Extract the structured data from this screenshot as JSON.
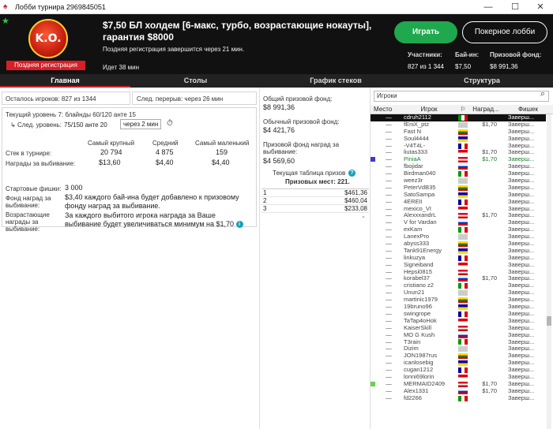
{
  "window": {
    "title": "Лобби турнира 2969845051",
    "minimize": "—",
    "maximize": "☐",
    "close": "✕"
  },
  "header": {
    "logo_text": "K.O.",
    "late_registration": "Поздняя регистрация",
    "title": "$7,50 БЛ холдем [6-макс, турбо, возрастающие нокауты], гарантия $8000",
    "reg_note": "Поздняя регистрация завершится через 21 мин.",
    "running": "Идет 38 мин",
    "play_label": "Играть",
    "lobby_label": "Покерное лобби",
    "participants_label": "Участники:",
    "participants_value": "827 из 1 344",
    "buyin_label": "Бай-ин:",
    "buyin_value": "$7,50",
    "prize_label": "Призовой фонд:",
    "prize_value": "$8 991,36"
  },
  "tabs": [
    "Главная",
    "Столы",
    "График стеков",
    "Структура"
  ],
  "main": {
    "players_left": "Осталось игроков: 827 из 1344",
    "next_break": "След. перерыв: через 26 мин",
    "current_level": "Текущий уровень 7:  блайнды 60/120 анте 15",
    "next_level_label": "След. уровень:",
    "next_level_value": "75/150 анте 20",
    "next_level_time": "через 2 мин",
    "stack_headers": [
      "Самый крупный",
      "Средний",
      "Самый маленький"
    ],
    "stack_row_label": "Стек в турнире:",
    "stack_values": [
      "20 794",
      "4 875",
      "159"
    ],
    "bounty_row_label": "Награды за выбивание:",
    "bounty_values": [
      "$13,60",
      "$4,40",
      "$4,40"
    ],
    "start_chips_label": "Стартовые фишки:",
    "start_chips_value": "3 000",
    "bounty_fund_label": "Фонд наград за выбивание:",
    "bounty_fund_value": "$3,40 каждого бай-ина будет добавлено к призовому фонду наград за выбивание.",
    "progressive_label": "Возрастающие награды за выбивание:",
    "progressive_value": "За каждого выбитого игрока награда за Ваше выбивание будет увеличиваться минимум на $1,70"
  },
  "prizes": {
    "total_label": "Общий призовой фонд:",
    "total_value": "$8 991,36",
    "regular_label": "Обычный призовой фонд:",
    "regular_value": "$4 421,76",
    "bounty_label": "Призовой фонд наград за выбивание:",
    "bounty_value": "$4 569,60",
    "current_table_label": "Текущая таблица призов",
    "places_label": "Призовых мест: 221.",
    "rows": [
      {
        "place": "1",
        "amount": "$461,36"
      },
      {
        "place": "2",
        "amount": "$460,04"
      },
      {
        "place": "3",
        "amount": "$233,08"
      }
    ]
  },
  "players": {
    "search_placeholder": "Игроки",
    "headers": {
      "place": "Место",
      "name": "Игрок",
      "flag": "⚐",
      "bounty": "Наград...",
      "chips": "Фишек"
    },
    "rows": [
      {
        "place": "—",
        "name": "cdruh2112",
        "bounty": "",
        "chips": "Заверш..."
      },
      {
        "place": "—",
        "name": "fEniX_ptz",
        "bounty": "$1,70",
        "chips": "Заверш..."
      },
      {
        "place": "—",
        "name": "Fast N",
        "bounty": "",
        "chips": "Заверш..."
      },
      {
        "place": "—",
        "name": "Soul4444",
        "bounty": "",
        "chips": "Заверш..."
      },
      {
        "place": "—",
        "name": "-V4T4L-",
        "bounty": "",
        "chips": "Заверш..."
      },
      {
        "place": "—",
        "name": "liutas333",
        "bounty": "$1,70",
        "chips": "Заверш..."
      },
      {
        "place": "—",
        "name": "PiniaA",
        "bounty": "$1,70",
        "chips": "Заверш..."
      },
      {
        "place": "—",
        "name": "fbojidar",
        "bounty": "",
        "chips": "Заверш..."
      },
      {
        "place": "—",
        "name": "Birdman040",
        "bounty": "",
        "chips": "Заверш..."
      },
      {
        "place": "—",
        "name": "weez3r",
        "bounty": "",
        "chips": "Заверш..."
      },
      {
        "place": "—",
        "name": "PeterVdB35",
        "bounty": "",
        "chips": "Заверш..."
      },
      {
        "place": "—",
        "name": "SatoSampa",
        "bounty": "",
        "chips": "Заверш..."
      },
      {
        "place": "—",
        "name": "4EREII",
        "bounty": "",
        "chips": "Заверш..."
      },
      {
        "place": "—",
        "name": "mexico_VI",
        "bounty": "",
        "chips": "Заверш..."
      },
      {
        "place": "—",
        "name": "AlexxxandrL",
        "bounty": "$1,70",
        "chips": "Заверш..."
      },
      {
        "place": "—",
        "name": "V for Vardan",
        "bounty": "",
        "chips": "Заверш..."
      },
      {
        "place": "—",
        "name": "exKam",
        "bounty": "",
        "chips": "Заверш..."
      },
      {
        "place": "—",
        "name": "LanexPro",
        "bounty": "",
        "chips": "Заверш..."
      },
      {
        "place": "—",
        "name": "abyss333",
        "bounty": "",
        "chips": "Заверш..."
      },
      {
        "place": "—",
        "name": "Tank91Energy",
        "bounty": "",
        "chips": "Заверш..."
      },
      {
        "place": "—",
        "name": "linkuzya",
        "bounty": "",
        "chips": "Заверш..."
      },
      {
        "place": "—",
        "name": "Signeiband",
        "bounty": "",
        "chips": "Заверш..."
      },
      {
        "place": "—",
        "name": "Hepsi0815",
        "bounty": "",
        "chips": "Заверш..."
      },
      {
        "place": "—",
        "name": "korabel37",
        "bounty": "$1,70",
        "chips": "Заверш..."
      },
      {
        "place": "—",
        "name": "cristiano z2",
        "bounty": "",
        "chips": "Заверш..."
      },
      {
        "place": "—",
        "name": "Unun21",
        "bounty": "",
        "chips": "Заверш..."
      },
      {
        "place": "—",
        "name": "martinic1979",
        "bounty": "",
        "chips": "Заверш..."
      },
      {
        "place": "—",
        "name": "19bruno96",
        "bounty": "",
        "chips": "Заверш..."
      },
      {
        "place": "—",
        "name": "swingrope",
        "bounty": "",
        "chips": "Заверш..."
      },
      {
        "place": "—",
        "name": "TaTap4oHok",
        "bounty": "",
        "chips": "Заверш..."
      },
      {
        "place": "—",
        "name": "KaiserSkill",
        "bounty": "",
        "chips": "Заверш..."
      },
      {
        "place": "—",
        "name": "MO G Kush",
        "bounty": "",
        "chips": "Заверш..."
      },
      {
        "place": "—",
        "name": "T3rain",
        "bounty": "",
        "chips": "Заверш..."
      },
      {
        "place": "—",
        "name": "Dizim",
        "bounty": "",
        "chips": "Заверш..."
      },
      {
        "place": "—",
        "name": "JON1987rus",
        "bounty": "",
        "chips": "Заверш..."
      },
      {
        "place": "—",
        "name": "icanlosebig",
        "bounty": "",
        "chips": "Заверш..."
      },
      {
        "place": "—",
        "name": "cugan1212",
        "bounty": "",
        "chips": "Заверш..."
      },
      {
        "place": "—",
        "name": "lonni69lorin",
        "bounty": "",
        "chips": "Заверш..."
      },
      {
        "place": "—",
        "name": "MERMAID2409",
        "bounty": "$1,70",
        "chips": "Заверш..."
      },
      {
        "place": "—",
        "name": "Alex1331",
        "bounty": "$1,70",
        "chips": "Заверш..."
      },
      {
        "place": "—",
        "name": "fd2266",
        "bounty": "",
        "chips": "Заверш..."
      }
    ]
  },
  "colors": {
    "accent_red": "#d71f27",
    "play_green": "#1fa84d",
    "header_bg": "#111111"
  }
}
